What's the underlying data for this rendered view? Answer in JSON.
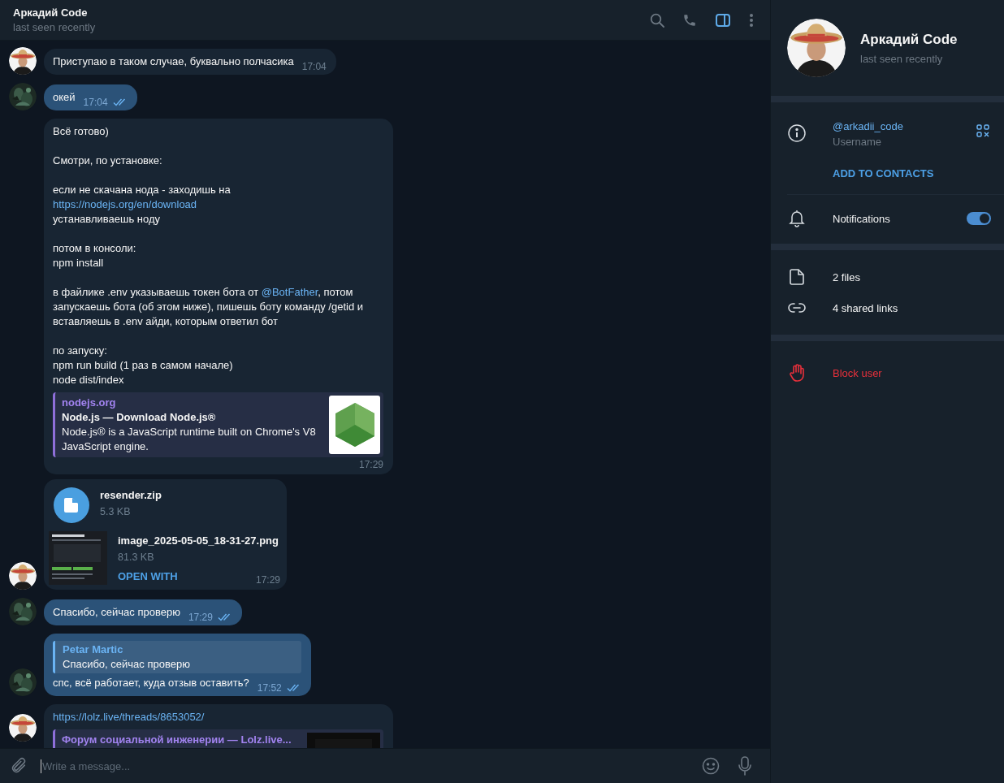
{
  "chat_header": {
    "title": "Аркадий Code",
    "status": "last seen recently",
    "actions": [
      {
        "kind": "search",
        "selected": false
      },
      {
        "kind": "call",
        "selected": false
      },
      {
        "kind": "sidebar",
        "selected": true
      },
      {
        "kind": "more",
        "selected": false
      }
    ]
  },
  "messages": [
    {
      "kind": "text",
      "outgoing": false,
      "show_avatar": true,
      "text": "Приступаю в таком случае, буквально полчасика",
      "time": "17:04"
    },
    {
      "kind": "text",
      "outgoing": true,
      "show_avatar": true,
      "text": "окей",
      "time": "17:04",
      "read": true
    },
    {
      "kind": "rich",
      "outgoing": false,
      "show_avatar": false,
      "paragraphs": [
        [
          {
            "kind": "text",
            "text": "Всё готово)"
          }
        ],
        [
          {
            "kind": "text",
            "text": "Смотри, по установке:"
          }
        ],
        [
          {
            "kind": "text",
            "text": "если не скачана нода - заходишь на\n"
          },
          {
            "kind": "link",
            "text": "https://nodejs.org/en/download"
          },
          {
            "kind": "text",
            "text": "\nустанавливаешь ноду"
          }
        ],
        [
          {
            "kind": "text",
            "text": "потом в консоли:\nnpm install"
          }
        ],
        [
          {
            "kind": "text",
            "text": "в файлике .env указываешь токен бота от "
          },
          {
            "kind": "link",
            "text": "@BotFather"
          },
          {
            "kind": "text",
            "text": ", потом запускаешь бота (об этом ниже), пишешь боту команду /getid и вставляешь в .env айди, которым ответил бот"
          }
        ],
        [
          {
            "kind": "text",
            "text": "по запуску:\nnpm run build (1 раз в самом начале)\nnode dist/index"
          }
        ]
      ],
      "preview": {
        "kind": "logo",
        "site": "nodejs.org",
        "title": "Node.js — Download Node.js®",
        "description": "Node.js® is a JavaScript runtime built on Chrome's V8 JavaScript engine."
      },
      "time": "17:29"
    },
    {
      "kind": "files",
      "outgoing": false,
      "show_avatar": true,
      "files": [
        {
          "kind": "document",
          "name": "resender.zip",
          "size": "5.3 KB"
        },
        {
          "name": "image_2025-05-05_18-31-27.png",
          "size": "81.3 KB",
          "action": "OPEN WITH"
        }
      ],
      "time": "17:29"
    },
    {
      "kind": "text",
      "outgoing": true,
      "show_avatar": true,
      "text": "Спасибо, сейчас проверю",
      "time": "17:29",
      "read": true
    },
    {
      "kind": "reply",
      "outgoing": true,
      "show_avatar": true,
      "reply": {
        "author": "Petar Martic",
        "text": "Спасибо, сейчас проверю"
      },
      "text": "спс, всё работает, куда отзыв оставить?",
      "time": "17:52",
      "read": true
    },
    {
      "kind": "rich",
      "outgoing": false,
      "show_avatar": true,
      "paragraphs": [
        [
          {
            "kind": "link",
            "text": "https://lolz.live/threads/8653052/"
          }
        ]
      ],
      "preview": {
        "kind": "picture",
        "site": "Форум социальной инженерии —  Lolz.live..."
      }
    }
  ],
  "composer": {
    "placeholder": "Write a message..."
  },
  "profile": {
    "name": "Аркадий Code",
    "status": "last seen recently",
    "username": "@arkadii_code",
    "username_label": "Username",
    "add_contact": "ADD TO CONTACTS",
    "notifications": {
      "label": "Notifications",
      "on": true
    },
    "media": [
      {
        "kind": "files",
        "label": "2 files"
      },
      {
        "kind": "links",
        "label": "4 shared links"
      }
    ],
    "block": "Block user"
  }
}
